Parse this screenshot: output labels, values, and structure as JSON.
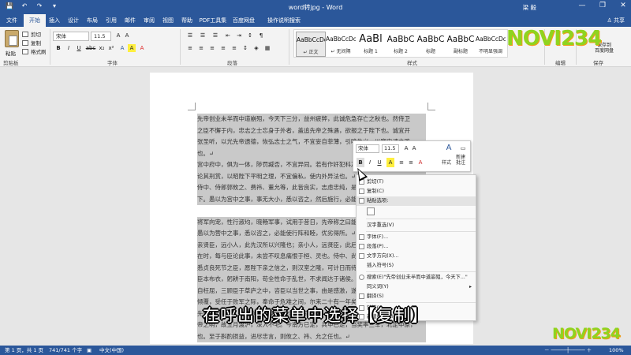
{
  "window": {
    "title": "word转jpg - Word",
    "user": "梁 毅",
    "controls": [
      "—",
      "❐",
      "✕"
    ],
    "quick_access": [
      "💾",
      "↶",
      "↷",
      "▾"
    ]
  },
  "tabs": [
    "文件",
    "开始",
    "插入",
    "设计",
    "布局",
    "引用",
    "邮件",
    "审阅",
    "视图",
    "帮助",
    "PDF工具集",
    "百度网盘",
    "操作说明搜索"
  ],
  "share_label": "♙ 共享",
  "ribbon": {
    "paste": "粘贴",
    "clipboard_items": [
      "剪切",
      "复制",
      "格式刷"
    ],
    "groups": {
      "clipboard": "剪贴板",
      "font": "字体",
      "paragraph": "段落",
      "styles": "样式",
      "editing": "编辑",
      "save": "保存"
    },
    "font_name": "宋体",
    "font_size": "11.5",
    "font_buttons": [
      "B",
      "I",
      "U",
      "abc",
      "x₂",
      "x²",
      "A",
      "A",
      "A"
    ],
    "para_buttons": [
      "☰",
      "☰",
      "☰",
      "⇤",
      "⇥",
      "↕",
      "¶"
    ],
    "styles": [
      {
        "sample": "AaBbCcDc",
        "name": "↵ 正文"
      },
      {
        "sample": "AaBbCcDc",
        "name": "↵ 无间隔"
      },
      {
        "sample": "AaBl",
        "name": "标题 1"
      },
      {
        "sample": "AaBbC",
        "name": "标题 2"
      },
      {
        "sample": "AaBbC",
        "name": "标题"
      },
      {
        "sample": "AaBbC",
        "name": "副标题"
      },
      {
        "sample": "AaBbCcDc",
        "name": "不明显强调"
      }
    ],
    "save_label": "保存到\n百度网盘"
  },
  "logo_text": "NOVI234",
  "document_lines": [
    "先帝创业未半而中道崩殂，今天下三分，益州疲弊，此诚危急存亡之秋也。然侍卫",
    "之臣不懈于内，忠志之士忘身于外者，盖追先帝之殊遇，欲报之于陛下也。诚宜开",
    "张圣听，以光先帝遗德，恢弘志士之气，不宜妄自菲薄，引喻失义，以塞忠谏之路",
    "也。↵",
    "宫中府中，俱为一体，陟罚臧否，不宜异同。若有作奸犯科及为忠善者，宜付有司",
    "论其刑赏，以昭陛下平明之理，不宜偏私，使内外异法也。↵",
    "侍中、侍郎郭攸之、费祎、董允等，此皆良实，志虑忠纯，是以先帝简拔以遗陛",
    "下。愚以为宫中之事，事无大小，悉以咨之，然后施行，必能裨补阙漏，有所广益。",
    "",
    "将军向宠，性行淑均，晓畅军事，试用于昔日，先帝称之曰能，是以众议举宠为督。",
    "愚以为营中之事，悉以咨之，必能使行阵和睦，优劣得所。↵",
    "亲贤臣，远小人，此先汉所以兴隆也；亲小人，远贤臣，此后汉所以倾颓也。先帝",
    "在时，每与臣论此事，未尝不叹息痛恨于桓、灵也。侍中、尚书、长史、参军，此",
    "悉贞良死节之臣，愿陛下亲之信之，则汉室之隆，可计日而待也。↵",
    "臣本布衣，躬耕于南阳，苟全性命于乱世，不求闻达于诸侯。先帝不以臣卑鄙，猥",
    "自枉屈，三顾臣于草庐之中，咨臣以当世之事，由是感激，遂许先帝以驱驰。后值",
    "倾覆，受任于败军之际，奉命于危难之间，尔来二十有一年矣。↵",
    "先帝知臣谨慎，故临崩寄臣以大事也。受命以来，夙夜忧叹，恐托付不效，以伤先",
    "帝之明，故五月渡泸，深入不毛。今南方已定，兵甲已足，当奖率三军，北定中原，",
    "也。至于斟酌损益，进尽忠言，则攸之、祎、允之任也。↵"
  ],
  "mini_toolbar": {
    "font": "宋体",
    "size": "11.5",
    "styles_label": "样式",
    "new_comment": "新建\n批注",
    "buttons": [
      "B",
      "I",
      "U",
      "A",
      "≡",
      "≡",
      "A"
    ]
  },
  "context_menu": [
    {
      "label": "剪切(T)",
      "icon": "scissors-icon"
    },
    {
      "label": "复制(C)",
      "icon": "copy-icon"
    },
    {
      "label": "粘贴选项:",
      "icon": "paste-icon",
      "hover": true
    },
    {
      "label": "",
      "icon": "paste-keep-text-icon"
    },
    {
      "label": "汉字重选(V)",
      "icon": ""
    },
    {
      "label": "字体(F)...",
      "icon": "font-icon"
    },
    {
      "label": "段落(P)...",
      "icon": "paragraph-icon"
    },
    {
      "label": "文字方向(X)...",
      "icon": "text-direction-icon"
    },
    {
      "label": "插入符号(S)",
      "icon": ""
    },
    {
      "label": "搜索(E)\"先帝创业未半而中道崩殂，今天下...\"",
      "icon": "search-icon"
    },
    {
      "label": "同义词(Y)",
      "icon": "",
      "submenu": true
    },
    {
      "label": "翻译(S)",
      "icon": "translate-icon"
    },
    {
      "label": "链接(I)",
      "icon": "link-icon"
    },
    {
      "label": "新建批注(M)",
      "icon": "comment-icon"
    }
  ],
  "subtitle": "在呼出的菜单中选择【复制】",
  "status": {
    "page": "第 1 页，共 1 页",
    "words": "741/741 个字",
    "language": "中文(中国)",
    "zoom": "100%"
  }
}
